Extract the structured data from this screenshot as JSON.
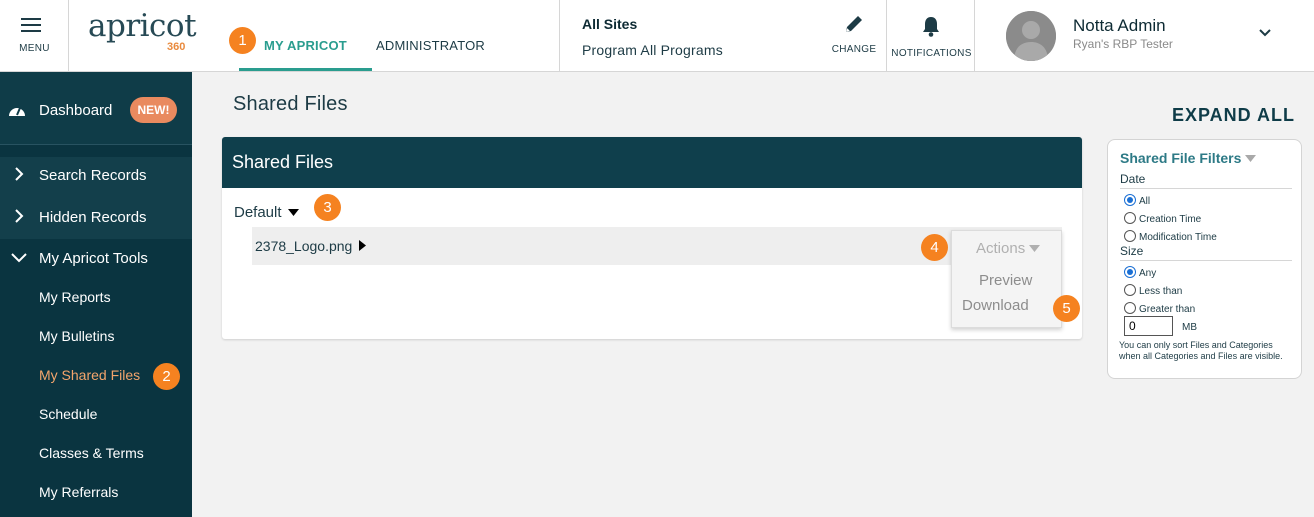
{
  "topbar": {
    "menu_label": "MENU",
    "logo_text": "apricot",
    "logo_sub": "360",
    "tabs": [
      {
        "label": "MY APRICOT",
        "badge": "1",
        "active": true
      },
      {
        "label": "ADMINISTRATOR",
        "active": false
      }
    ],
    "site": {
      "title": "All Sites",
      "program": "Program All Programs"
    },
    "change_label": "CHANGE",
    "notifications_label": "NOTIFICATIONS",
    "user": {
      "name": "Notta Admin",
      "subtitle": "Ryan's RBP Tester"
    }
  },
  "sidebar": {
    "dashboard": {
      "label": "Dashboard",
      "badge": "NEW!"
    },
    "items": [
      {
        "label": "Search Records"
      },
      {
        "label": "Hidden Records"
      },
      {
        "label": "My Apricot Tools"
      }
    ],
    "tools": [
      {
        "label": "My Reports"
      },
      {
        "label": "My Bulletins"
      },
      {
        "label": "My Shared Files",
        "badge": "2",
        "active": true
      },
      {
        "label": "Schedule"
      },
      {
        "label": "Classes & Terms"
      },
      {
        "label": "My Referrals"
      }
    ]
  },
  "main": {
    "page_title": "Shared Files",
    "expand_all": "EXPAND ALL",
    "panel": {
      "title": "Shared Files",
      "category": "Default",
      "category_badge": "3",
      "file_name": "2378_Logo.png",
      "actions": {
        "label": "Actions",
        "badge": "4",
        "items": [
          "Preview",
          "Download"
        ],
        "download_badge": "5"
      }
    }
  },
  "filters": {
    "title": "Shared File Filters",
    "date_label": "Date",
    "date_options": [
      {
        "label": "All",
        "checked": true
      },
      {
        "label": "Creation Time",
        "checked": false
      },
      {
        "label": "Modification Time",
        "checked": false
      }
    ],
    "size_label": "Size",
    "size_options": [
      {
        "label": "Any",
        "checked": true
      },
      {
        "label": "Less than",
        "checked": false
      },
      {
        "label": "Greater than",
        "checked": false
      }
    ],
    "size_value": "0",
    "size_unit": "MB",
    "note": "You can only sort Files and Categories when all Categories and Files are visible."
  },
  "colors": {
    "accent": "#2a9d8f",
    "badge": "#f58220",
    "sidebar_bg": "#0a3440",
    "panel_head": "#0f3f4c"
  }
}
